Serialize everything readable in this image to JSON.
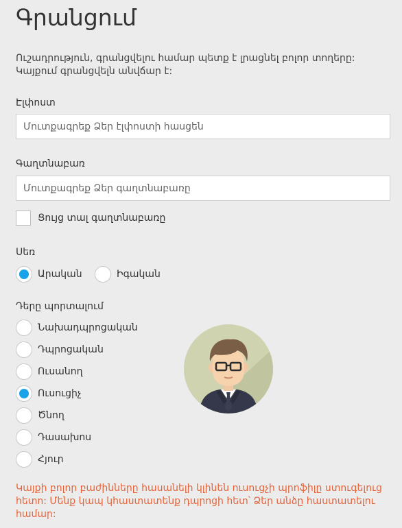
{
  "page": {
    "title": "Գրանցում",
    "notice": "Ուշադրություն, գրանցվելու համար պետք է լրացնել բոլոր տողերը: Կայքում գրանցվելն անվճար է:"
  },
  "email": {
    "label": "Էլփոստ",
    "placeholder": "Մուտքագրեք Ձեր էլփոստի հասցեն",
    "value": ""
  },
  "password": {
    "label": "Գաղտնաբառ",
    "placeholder": "Մուտքագրեք Ձեր գաղտնաբառը",
    "value": "",
    "show_label": "Ցույց տալ գաղտնաբառը",
    "show_checked": false
  },
  "gender": {
    "label": "Սեռ",
    "options": [
      {
        "label": "Արական",
        "checked": true
      },
      {
        "label": "Իգական",
        "checked": false
      }
    ]
  },
  "role": {
    "label": "Դերը պորտալում",
    "options": [
      {
        "label": "Նախադպրոցական",
        "checked": false
      },
      {
        "label": "Դպրոցական",
        "checked": false
      },
      {
        "label": "Ուսանող",
        "checked": false
      },
      {
        "label": "Ուսուցիչ",
        "checked": true
      },
      {
        "label": "Ծնող",
        "checked": false
      },
      {
        "label": "Դասախոս",
        "checked": false
      },
      {
        "label": "Հյուր",
        "checked": false
      }
    ]
  },
  "avatar": {
    "icon": "teacher-avatar-icon"
  },
  "footer_note": "Կայքի բոլոր բաժինները հասանելի կլինեն ուսուցչի պրոֆիլը ստուգելուց հետո: Մենք կապ կհաստատենք դպրոցի հետ՝ Ձեր անձը հաստատելու համար:",
  "colors": {
    "accent": "#1aa3e8",
    "warning": "#e3643a",
    "background": "#ececec"
  }
}
